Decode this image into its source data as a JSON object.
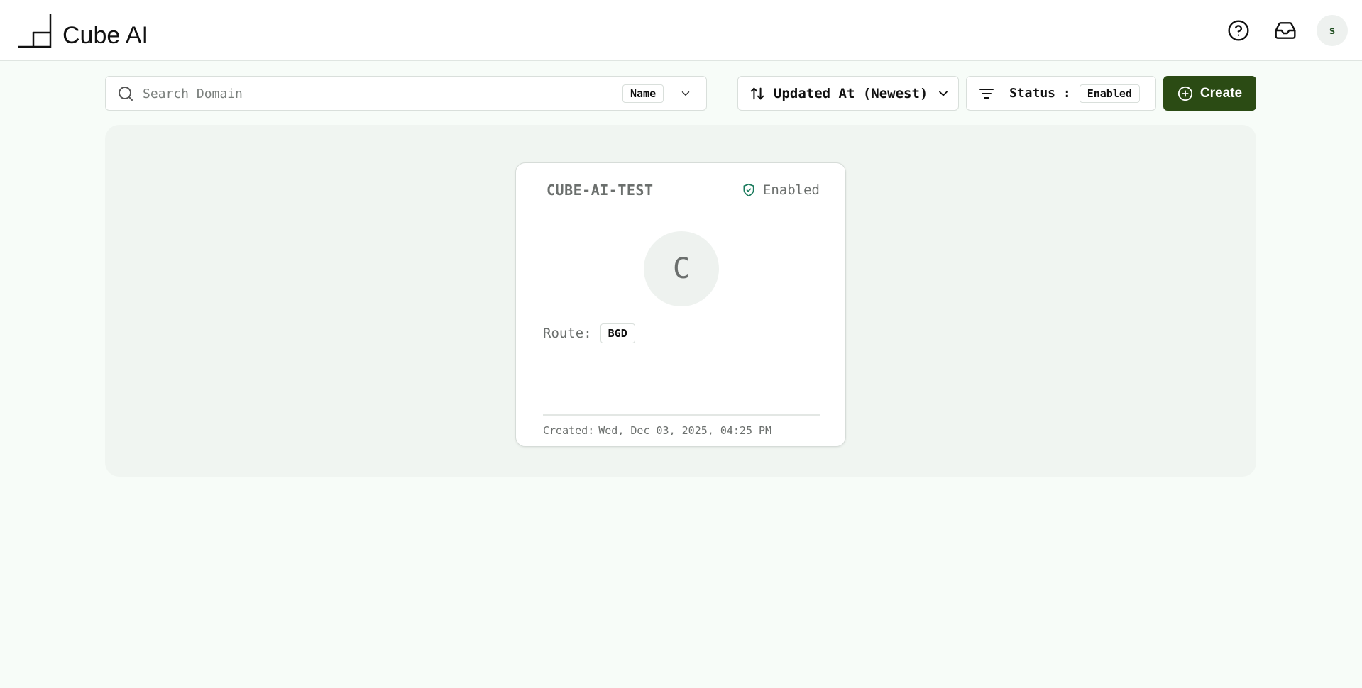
{
  "app": {
    "title": "Cube AI"
  },
  "header": {
    "avatar_initial": "s"
  },
  "search": {
    "placeholder": "Search Domain",
    "value": "",
    "field": "Name"
  },
  "sort": {
    "label": "Updated At (Newest)"
  },
  "filter": {
    "label": "Status :",
    "value": "Enabled"
  },
  "create": {
    "label": "Create"
  },
  "card": {
    "title": "CUBE-AI-TEST",
    "status": "Enabled",
    "initial": "C",
    "route_label": "Route:",
    "route_value": "BGD",
    "created_label": "Created:",
    "created_value": "Wed, Dec 03, 2025, 04:25 PM"
  },
  "colors": {
    "accent": "#2b4b14",
    "status_icon": "#1a7a5c",
    "background": "#f7fcf8",
    "panel": "#f0f5f1"
  },
  "icons": [
    "logo-icon",
    "help-icon",
    "inbox-icon",
    "search-icon",
    "chevron-down-icon",
    "sort-arrows-icon",
    "filter-icon",
    "plus-circle-icon",
    "shield-check-icon"
  ]
}
